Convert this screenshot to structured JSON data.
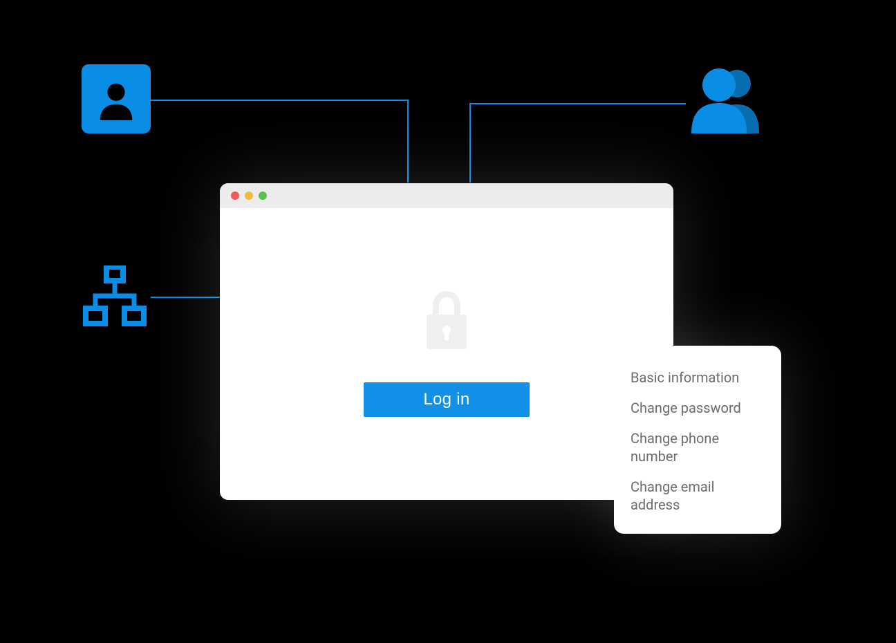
{
  "browser_window": {
    "login_button_label": "Log in"
  },
  "menu": {
    "items": [
      {
        "label": "Basic information"
      },
      {
        "label": "Change password"
      },
      {
        "label": "Change phone number"
      },
      {
        "label": "Change email address"
      }
    ]
  },
  "icons": {
    "user_single": "user-single-icon",
    "org_chart": "org-chart-icon",
    "users_group": "users-group-icon",
    "lock": "lock-icon"
  },
  "colors": {
    "accent": "#0a8ee5",
    "button": "#128fe7",
    "menu_text": "#6b6b70"
  }
}
